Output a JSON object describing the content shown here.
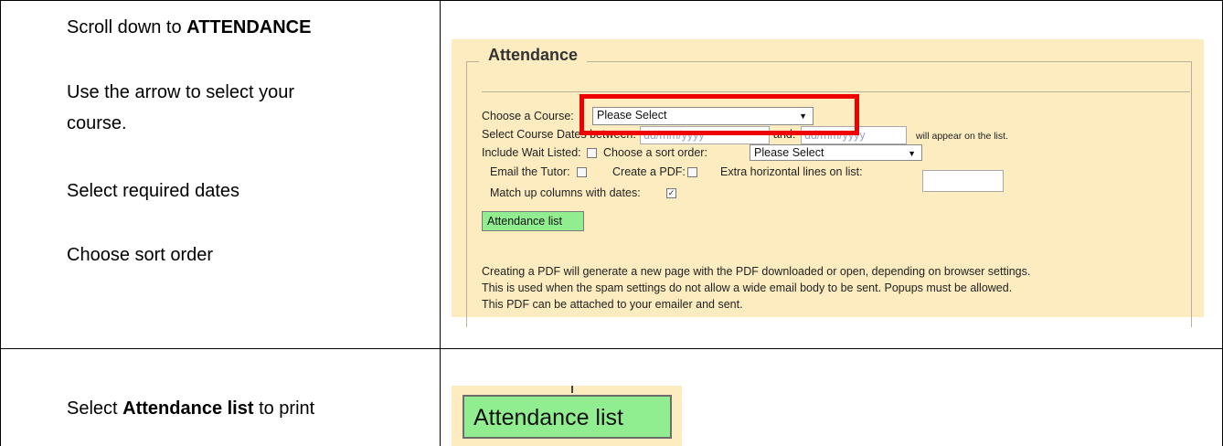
{
  "instructions": {
    "row1": {
      "scroll_prefix": "Scroll down to ",
      "scroll_bold": "ATTENDANCE",
      "arrow_line1": "Use the arrow to select your",
      "arrow_line2": "course.",
      "dates": "Select required dates",
      "sort": "Choose sort order"
    },
    "row2": {
      "select_prefix": "Select ",
      "select_bold": "Attendance list",
      "select_suffix": " to print"
    }
  },
  "attendance_panel": {
    "legend": "Attendance",
    "course_label": "Choose a Course:",
    "course_select_value": "Please Select",
    "dates_label": "Select Course Dates between:",
    "date_from_placeholder": "dd/mm/yyyy",
    "and_label": "and:",
    "date_to_placeholder": "dd/mm/yyyy",
    "dates_suffix": "will appear on the list.",
    "wait_listed_label": "Include Wait Listed:",
    "sort_label": "Choose a sort order:",
    "sort_select_value": "Please Select",
    "email_tutor_label": "Email the Tutor:",
    "create_pdf_label": "Create a PDF:",
    "extra_lines_label": "Extra horizontal lines on list:",
    "match_columns_label": "Match up columns with dates:",
    "match_columns_checked": true,
    "button_label": "Attendance list",
    "info_line1": "Creating a PDF will generate a new page with the PDF downloaded or open, depending on browser settings.",
    "info_line2": "This is used when the spam settings do not allow a wide email body to be sent. Popups must be allowed.",
    "info_line3": "This PDF can be attached to your emailer and sent.",
    "highlight_color": "#ee0000",
    "panel_color": "#fcecc0",
    "button_color": "#90ee90"
  },
  "zoomed_button": {
    "label": "Attendance list"
  }
}
